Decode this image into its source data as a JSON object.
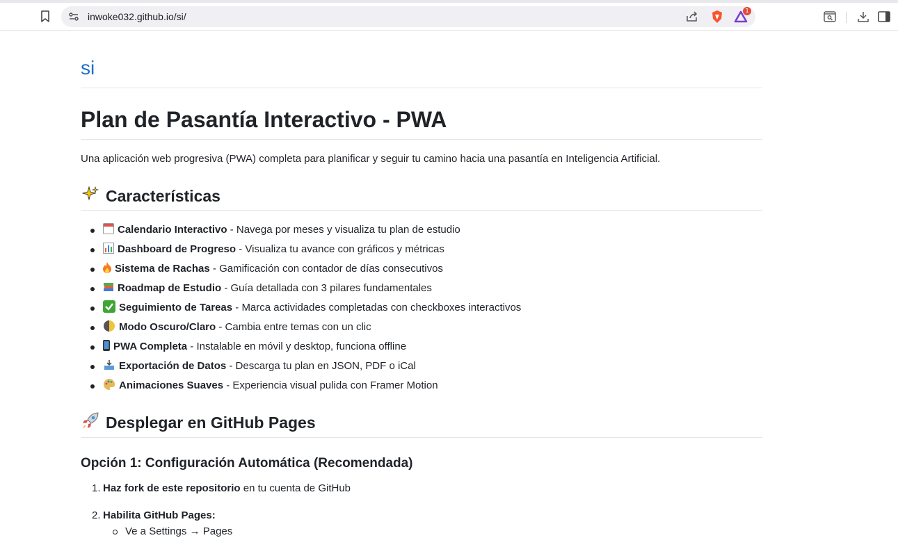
{
  "browser": {
    "url": "inwoke032.github.io/si/",
    "badge_count": "1",
    "icons": [
      "bookmark-icon",
      "site-settings-icon",
      "share-icon",
      "brave-shield-icon",
      "brave-rewards-icon",
      "tab-search-icon",
      "download-icon",
      "sidebar-icon"
    ]
  },
  "page": {
    "site_title": "si",
    "heading": "Plan de Pasantía Interactivo - PWA",
    "intro": "Una aplicación web progresiva (PWA) completa para planificar y seguir tu camino hacia una pasantía en Inteligencia Artificial.",
    "features_heading": "Características",
    "features": [
      {
        "icon": "calendar-icon",
        "title": "Calendario Interactivo",
        "desc": " - Navega por meses y visualiza tu plan de estudio"
      },
      {
        "icon": "bar-chart-icon",
        "title": "Dashboard de Progreso",
        "desc": " - Visualiza tu avance con gráficos y métricas"
      },
      {
        "icon": "fire-icon",
        "title": "Sistema de Rachas",
        "desc": " - Gamificación con contador de días consecutivos"
      },
      {
        "icon": "books-icon",
        "title": "Roadmap de Estudio",
        "desc": " - Guía detallada con 3 pilares fundamentales"
      },
      {
        "icon": "check-mark-icon",
        "title": "Seguimiento de Tareas",
        "desc": " - Marca actividades completadas con checkboxes interactivos"
      },
      {
        "icon": "moon-icon",
        "title": "Modo Oscuro/Claro",
        "desc": " - Cambia entre temas con un clic"
      },
      {
        "icon": "mobile-phone-icon",
        "title": "PWA Completa",
        "desc": " - Instalable en móvil y desktop, funciona offline"
      },
      {
        "icon": "inbox-tray-icon",
        "title": "Exportación de Datos",
        "desc": " - Descarga tu plan en JSON, PDF o iCal"
      },
      {
        "icon": "palette-icon",
        "title": "Animaciones Suaves",
        "desc": " - Experiencia visual pulida con Framer Motion"
      }
    ],
    "deploy_heading": "Desplegar en GitHub Pages",
    "option1_heading": "Opción 1: Configuración Automática (Recomendada)",
    "steps": [
      {
        "num": "1.",
        "title": "Haz fork de este repositorio",
        "rest": " en tu cuenta de GitHub"
      },
      {
        "num": "2.",
        "title": "Habilita GitHub Pages:",
        "rest": ""
      }
    ],
    "step2_sub": [
      "Ve a Settings → Pages"
    ]
  },
  "colors": {
    "link": "#1f6fc6",
    "text": "#1f2328",
    "rule": "#e1e4e8"
  }
}
